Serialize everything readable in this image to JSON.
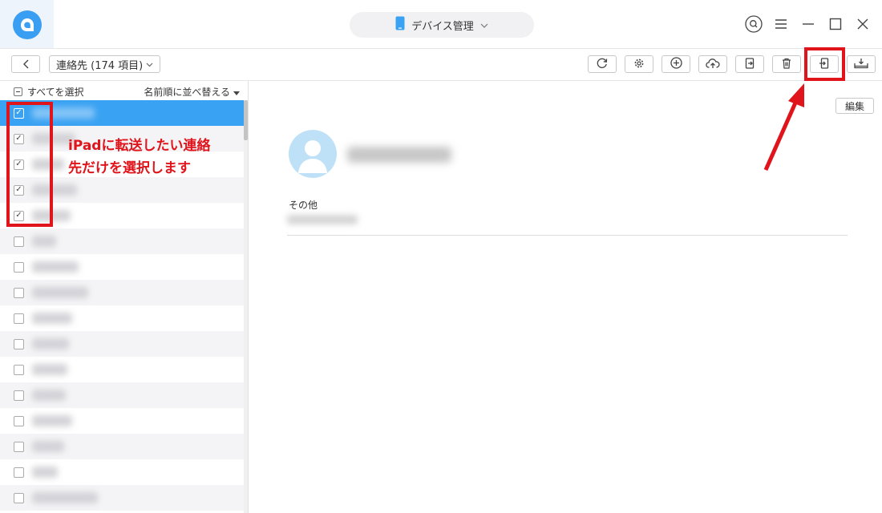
{
  "titlebar": {
    "device_title": "デバイス管理"
  },
  "toolbar": {
    "category_label": "連絡先 (174 項目)"
  },
  "list_header": {
    "select_all_label": "すべてを選択",
    "sort_label": "名前順に並べ替える"
  },
  "contacts": [
    {
      "checked": true,
      "selected": true
    },
    {
      "checked": true
    },
    {
      "checked": true
    },
    {
      "checked": true
    },
    {
      "checked": true
    },
    {
      "checked": false
    },
    {
      "checked": false
    },
    {
      "checked": false
    },
    {
      "checked": false
    },
    {
      "checked": false
    },
    {
      "checked": false
    },
    {
      "checked": false
    },
    {
      "checked": false
    },
    {
      "checked": false
    },
    {
      "checked": false
    },
    {
      "checked": false
    }
  ],
  "detail": {
    "edit_label": "編集",
    "section_other_label": "その他"
  },
  "annotation": {
    "callout_text": "iPadに転送したい連絡\n先だけを選択します",
    "color": "#e0141b"
  },
  "colors": {
    "accent": "#3aa2f2",
    "annotation_red": "#e0141b"
  },
  "icons": {
    "toolbar": [
      "refresh-icon",
      "settings-icon",
      "add-icon",
      "upload-cloud-icon",
      "export-icon",
      "delete-icon",
      "to-device-icon",
      "to-pc-icon"
    ]
  }
}
